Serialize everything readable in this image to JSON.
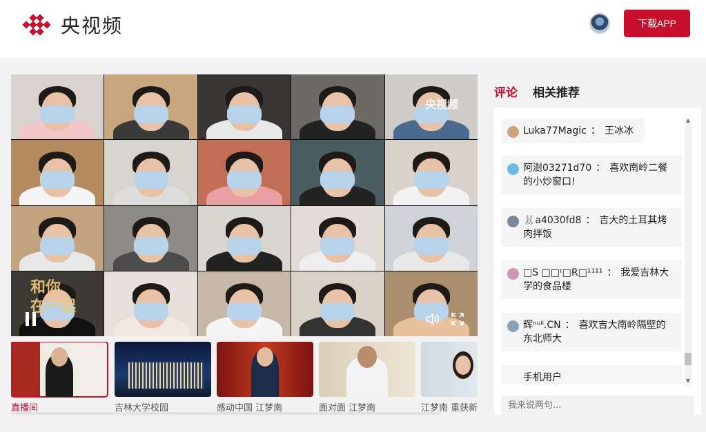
{
  "header": {
    "brand": "央视频",
    "download_label": "下载APP",
    "logo_color": "#c8102e"
  },
  "player": {
    "watermark": "央视频",
    "slogan_line1": "和你",
    "slogan_line2": "在一起",
    "icons": [
      "pause-icon",
      "volume-icon",
      "fullscreen-icon"
    ]
  },
  "thumbnails": [
    {
      "caption": "直播间",
      "active": true
    },
    {
      "caption": "吉林大学校园",
      "active": false
    },
    {
      "caption": "感动中国 江梦南",
      "active": false
    },
    {
      "caption": "面对面 江梦南",
      "active": false
    },
    {
      "caption": "江梦南 重获新",
      "active": false
    }
  ],
  "tabs": [
    {
      "label": "评论",
      "active": true
    },
    {
      "label": "相关推荐",
      "active": false
    }
  ],
  "comments": [
    {
      "user": "Luka77Magic",
      "sep": "：",
      "text": "王冰冰"
    },
    {
      "user": "阿澍03271d70",
      "sep": "：",
      "text": "喜欢南岭二餐的小炒窗口!"
    },
    {
      "user": "🐰a4030fd8",
      "sep": "：",
      "text": "吉大的土耳其烤肉拌饭"
    },
    {
      "user": "□S □□ᶦ□R□¹¹¹¹",
      "sep": "：",
      "text": "我爱吉林大学的食品楼"
    },
    {
      "user": "辉ⁿᵘˡˡ.CN",
      "sep": "：",
      "text": "喜欢吉大南岭隔壁的东北师大"
    },
    {
      "user": "手机用户",
      "sep": "",
      "text": ""
    }
  ],
  "comment_input": {
    "placeholder": "我来说两句..."
  }
}
